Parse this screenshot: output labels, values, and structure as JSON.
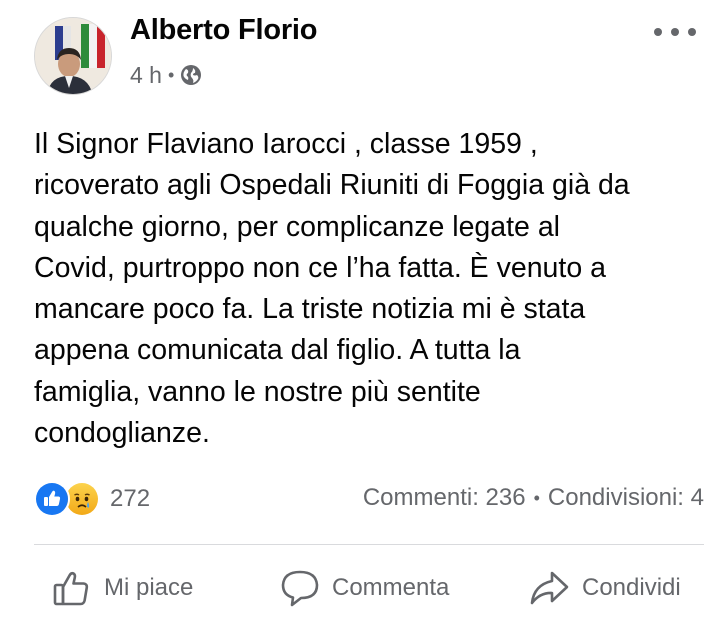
{
  "post": {
    "author": "Alberto Florio",
    "time": "4 h",
    "meta_separator": "•",
    "privacy_icon": "globe-icon",
    "more_icon": "more-options-icon",
    "text_lines": [
      "Il Signor Flaviano Iarocci , classe 1959 ,",
      "ricoverato agli Ospedali Riuniti di Foggia già da",
      "qualche giorno, per complicanze legate al",
      "Covid, purtroppo non ce l’ha fatta. È venuto a",
      "mancare poco fa. La triste notizia mi è stata",
      "appena comunicata dal figlio. A tutta la",
      "famiglia, vanno le nostre più sentite",
      "condoglianze."
    ]
  },
  "reactions": {
    "icons": [
      "like-reaction-icon",
      "sad-reaction-icon"
    ],
    "count": "272",
    "comments": "Commenti: 236",
    "separator": "•",
    "shares": "Condivisioni: 4"
  },
  "actions": {
    "like_label": "Mi piace",
    "comment_label": "Commenta",
    "share_label": "Condividi"
  },
  "colors": {
    "text": "#050505",
    "secondary": "#65676b",
    "like_blue": "#1877f2",
    "sad_yellow": "#f7b125",
    "divider": "#d9dadd"
  }
}
